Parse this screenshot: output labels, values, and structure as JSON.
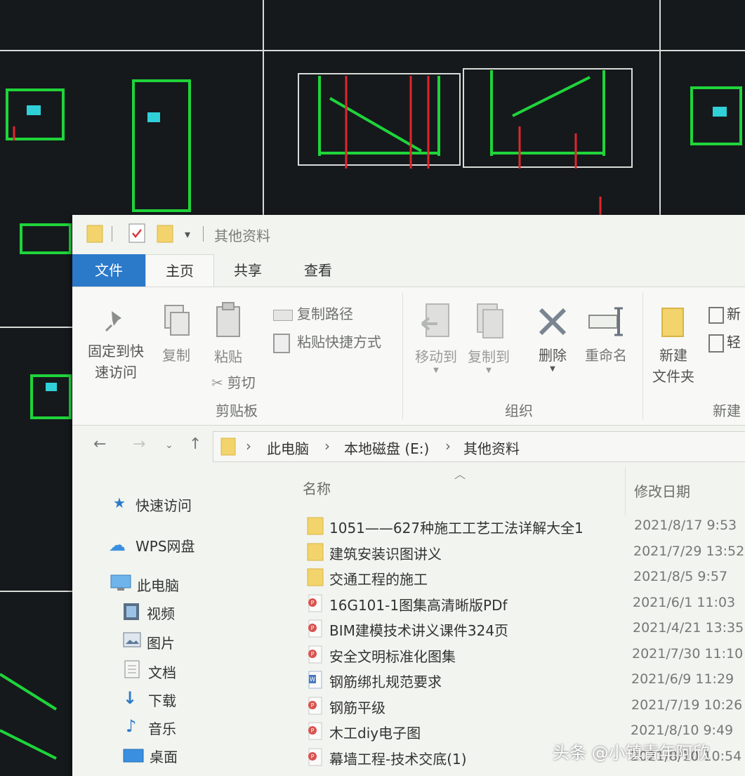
{
  "window": {
    "title": "其他资料"
  },
  "ribbon_tabs": [
    "文件",
    "主页",
    "共享",
    "查看"
  ],
  "ribbon": {
    "pin_line1": "固定到快",
    "pin_line2": "速访问",
    "copy": "复制",
    "paste": "粘贴",
    "copy_path": "复制路径",
    "paste_shortcut": "粘贴快捷方式",
    "cut": "剪切",
    "clipboard_group": "剪贴板",
    "move_to": "移动到",
    "copy_to": "复制到",
    "delete": "删除",
    "rename": "重命名",
    "organize_group": "组织",
    "new_folder_line1": "新建",
    "new_folder_line2": "文件夹",
    "new_item_partial": "新",
    "easy_access_partial": "轻",
    "new_group": "新建"
  },
  "address": {
    "crumbs": [
      "此电脑",
      "本地磁盘 (E:)",
      "其他资料"
    ]
  },
  "nav": {
    "quick_access": "快速访问",
    "wps": "WPS网盘",
    "this_pc": "此电脑",
    "videos": "视频",
    "pictures": "图片",
    "documents": "文档",
    "downloads": "下载",
    "music": "音乐",
    "desktop": "桌面"
  },
  "list": {
    "col_name": "名称",
    "col_date": "修改日期",
    "files": [
      {
        "name": "1051——627种施工工艺工法详解大全1",
        "date": "2021/8/17 9:53",
        "type": "folder"
      },
      {
        "name": "建筑安装识图讲义",
        "date": "2021/7/29 13:52",
        "type": "folder"
      },
      {
        "name": "交通工程的施工",
        "date": "2021/8/5 9:57",
        "type": "folder"
      },
      {
        "name": "16G101-1图集高清晰版PDf",
        "date": "2021/6/1 11:03",
        "type": "pdf"
      },
      {
        "name": "BIM建模技术讲义课件324页",
        "date": "2021/4/21 13:35",
        "type": "pdf"
      },
      {
        "name": "安全文明标准化图集",
        "date": "2021/7/30 11:10",
        "type": "pdf"
      },
      {
        "name": "钢筋绑扎规范要求",
        "date": "2021/6/9 11:29",
        "type": "doc"
      },
      {
        "name": "钢筋平级",
        "date": "2021/7/19 10:26",
        "type": "pdf"
      },
      {
        "name": "木工diy电子图",
        "date": "2021/8/10 9:49",
        "type": "pdf"
      },
      {
        "name": "幕墙工程-技术交底(1)",
        "date": "2021/8/10 10:54",
        "type": "pdf"
      }
    ]
  },
  "watermark": "头条 @小镇青年阿欣",
  "colors": {
    "file_tab": "#2b79c9",
    "cad_background": "#15191c",
    "cad_green": "#1fd43a",
    "cad_red": "#e0262b",
    "folder": "#f3d36b",
    "pdf": "#d9534f"
  }
}
